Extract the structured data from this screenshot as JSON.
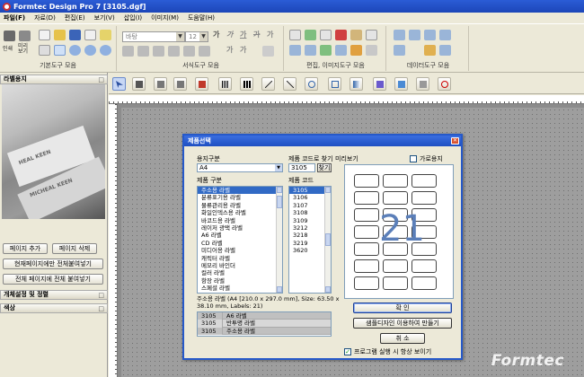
{
  "window": {
    "title": "Formtec Design Pro 7 [3105.dgf]"
  },
  "menu": [
    "파일(F)",
    "자료(D)",
    "편집(E)",
    "보기(V)",
    "삽입(I)",
    "이미지(M)",
    "도움말(H)"
  ],
  "toolbar": {
    "groups": [
      "기본도구 모음",
      "서식도구 모음",
      "편집, 이미지도구 모음",
      "데이터도구 모음"
    ],
    "print_label": "인쇄",
    "preview_label": "미리보기",
    "font_name": "바탕",
    "font_size": "12",
    "format_glyphs": [
      "가",
      "가",
      "가",
      "가",
      "가",
      "가",
      "가"
    ]
  },
  "left_panel": {
    "title": "라벨용지",
    "add_page": "페이지 추가",
    "delete_page": "페이지 삭제",
    "paste_all_current": "현재페이지에만 전체붙여넣기",
    "paste_all_pages": "전체 페이지에 전체 붙여넣기",
    "section_object": "개체설정 및 정렬",
    "section_color": "색상",
    "photo_texts": [
      "HEAL KEEN",
      "MICHEAL KEEN"
    ]
  },
  "dialog": {
    "title": "제품선택",
    "paper_type_label": "용지구분",
    "paper_type_value": "A4",
    "find_code_label": "제품 코드로 찾기",
    "find_code_value": "3105",
    "find_button": "찾기",
    "preview_label": "미리보기",
    "landscape_label": "가로용지",
    "category_label": "제품 구분",
    "code_label": "제품 코드",
    "categories": [
      "주소용 라벨",
      "분류표기용 라벨",
      "물류관리용 라벨",
      "화일인덱스용 라벨",
      "바코드용 라벨",
      "레이저 광택 라벨",
      "A6 라벨",
      "CD 라벨",
      "미디어용 라벨",
      "캐릭터 라벨",
      "메모리 바인더",
      "컬러 라벨",
      "항장 라벨",
      "스페셜 라벨"
    ],
    "codes": [
      "3105",
      "3106",
      "3107",
      "3108",
      "3109",
      "3212",
      "3218",
      "3219",
      "3620"
    ],
    "preview_count": "21",
    "description": "주소용 라벨 (A4 [210.0 x 297.0 mm], Size: 63.50 x 38.10 mm, Labels: 21)",
    "history": [
      {
        "code": "3105",
        "name": "A6 라벨"
      },
      {
        "code": "3105",
        "name": "반투명 라벨"
      },
      {
        "code": "3105",
        "name": "주소용 라벨"
      }
    ],
    "ok_button": "확 인",
    "design_button": "샘플디자인 이용하여 만들기",
    "cancel_button": "취 소",
    "show_on_start": "프로그램 실행 시 항상 보이기"
  },
  "brand": "Formtec",
  "colors": {
    "titlebar": "#1c46b8",
    "selection": "#316ac5",
    "dialog_border": "#2659c9",
    "preview_number": "#5b7fb9"
  }
}
